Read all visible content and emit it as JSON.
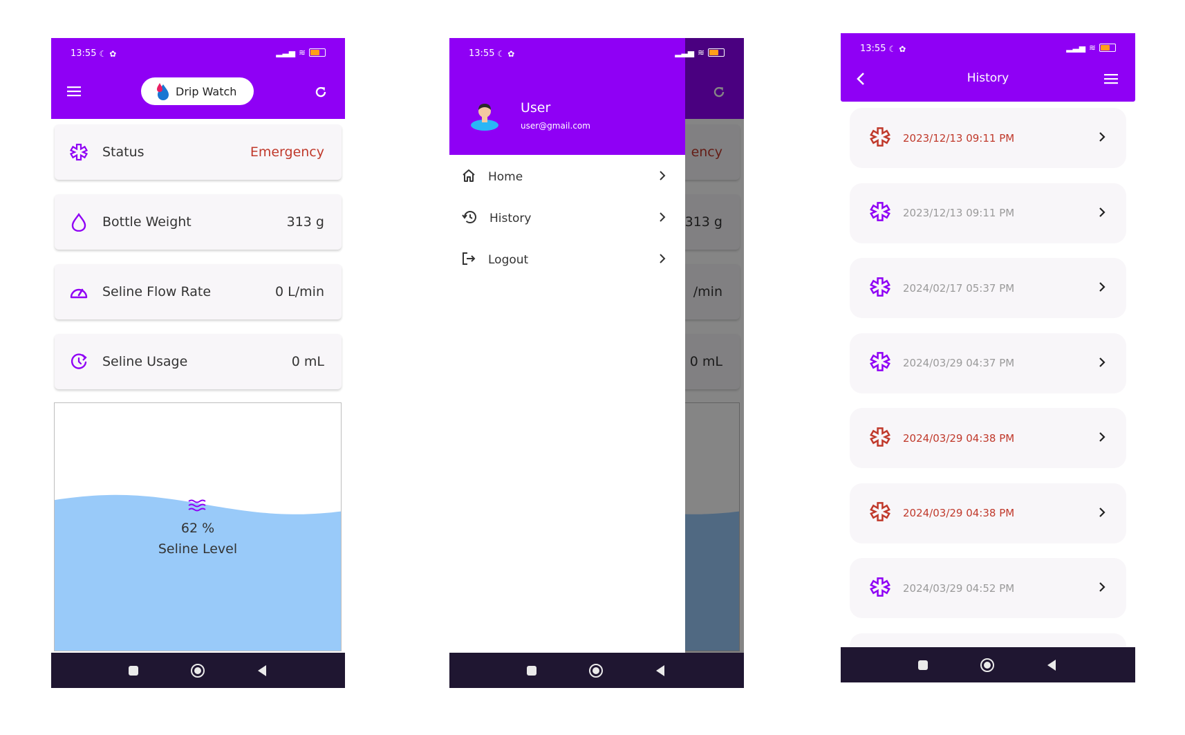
{
  "colors": {
    "primary": "#8f00f5",
    "emergency": "#c0392b",
    "navbar": "#1f1631",
    "water": "#99caf9",
    "card": "#f8f6f9"
  },
  "status_bar": {
    "time": "13:55"
  },
  "dashboard": {
    "brand": "Drip Watch",
    "cards": [
      {
        "icon": "status-icon",
        "label": "Status",
        "value": "Emergency"
      },
      {
        "icon": "drop-icon",
        "label": "Bottle Weight",
        "value": "313 g"
      },
      {
        "icon": "speedometer-icon",
        "label": "Seline Flow Rate",
        "value": "0 L/min"
      },
      {
        "icon": "usage-icon",
        "label": "Seline Usage",
        "value": "0 mL"
      }
    ],
    "level": {
      "percent_text": "62 %",
      "label": "Seline Level",
      "fill_percent": 62
    }
  },
  "drawer": {
    "user_name": "User",
    "user_email": "user@gmail.com",
    "items": [
      {
        "label": "Home",
        "icon": "home-icon"
      },
      {
        "label": "History",
        "icon": "history-icon"
      },
      {
        "label": "Logout",
        "icon": "logout-icon"
      }
    ],
    "background_values": [
      "ency",
      "313 g",
      "/min",
      "0 mL"
    ]
  },
  "history": {
    "title": "History",
    "entries": [
      {
        "date": "2023/12/13 09:11 PM",
        "status": "emergency"
      },
      {
        "date": "2023/12/13 09:11 PM",
        "status": "normal"
      },
      {
        "date": "2024/02/17 05:37 PM",
        "status": "normal"
      },
      {
        "date": "2024/03/29 04:37 PM",
        "status": "normal"
      },
      {
        "date": "2024/03/29 04:38 PM",
        "status": "emergency"
      },
      {
        "date": "2024/03/29 04:38 PM",
        "status": "emergency"
      },
      {
        "date": "2024/03/29 04:52 PM",
        "status": "normal"
      }
    ]
  }
}
